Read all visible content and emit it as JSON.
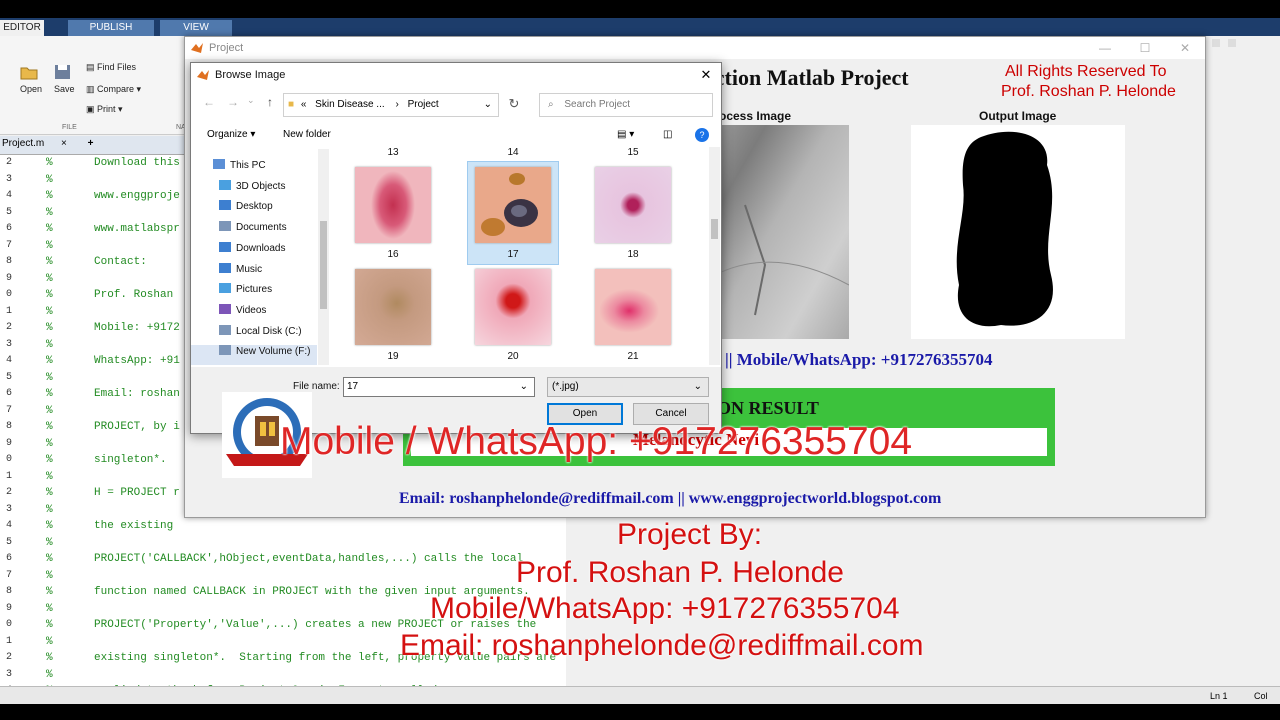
{
  "matlab": {
    "tabs": [
      "EDITOR",
      "PUBLISH",
      "VIEW"
    ],
    "toolstrip": {
      "open": "Open",
      "save": "Save",
      "find_files": "Find Files",
      "compare": "Compare",
      "print": "Print",
      "section_file": "FILE",
      "section_na": "NA"
    },
    "editor_tab": "Project.m",
    "code_lines": [
      {
        "n": "2",
        "text": "Download this"
      },
      {
        "n": "3",
        "text": ""
      },
      {
        "n": "4",
        "text": "www.enggproje"
      },
      {
        "n": "5",
        "text": ""
      },
      {
        "n": "6",
        "text": "www.matlabspr"
      },
      {
        "n": "7",
        "text": ""
      },
      {
        "n": "8",
        "text": "Contact:"
      },
      {
        "n": "9",
        "text": ""
      },
      {
        "n": "0",
        "text": "Prof. Roshan"
      },
      {
        "n": "1",
        "text": ""
      },
      {
        "n": "2",
        "text": "Mobile: +9172"
      },
      {
        "n": "3",
        "text": ""
      },
      {
        "n": "4",
        "text": "WhatsApp: +91"
      },
      {
        "n": "5",
        "text": ""
      },
      {
        "n": "6",
        "text": "Email: roshan"
      },
      {
        "n": "7",
        "text": ""
      },
      {
        "n": "8",
        "text": "PROJECT, by i"
      },
      {
        "n": "9",
        "text": ""
      },
      {
        "n": "0",
        "text": "singleton*."
      },
      {
        "n": "1",
        "text": ""
      },
      {
        "n": "2",
        "text": "H = PROJECT r"
      },
      {
        "n": "3",
        "text": ""
      },
      {
        "n": "4",
        "text": "the existing"
      },
      {
        "n": "5",
        "text": ""
      },
      {
        "n": "6",
        "text": "PROJECT('CALLBACK',hObject,eventData,handles,...) calls the local"
      },
      {
        "n": "7",
        "text": ""
      },
      {
        "n": "8",
        "text": "function named CALLBACK in PROJECT with the given input arguments."
      },
      {
        "n": "9",
        "text": ""
      },
      {
        "n": "0",
        "text": "PROJECT('Property','Value',...) creates a new PROJECT or raises the"
      },
      {
        "n": "1",
        "text": ""
      },
      {
        "n": "2",
        "text": "existing singleton*.  Starting from the left, property value pairs are"
      },
      {
        "n": "3",
        "text": ""
      },
      {
        "n": "4",
        "text": "applied to the before Project_OpeningFcn gets called."
      }
    ],
    "status": {
      "ln": "Ln  1",
      "col": "Col"
    }
  },
  "project_window": {
    "title": "Project",
    "heading": "ection Matlab Project",
    "rights_line1": "All Rights Reserved To",
    "rights_line2": "Prof. Roshan P. Helonde",
    "process_label": "ocess Image",
    "output_label": "Output Image",
    "mobile_line": "||   Mobile/WhatsApp: +917276355704",
    "result_title": "ON RESULT",
    "result_value": "Melanocytic Nevi",
    "email_line": "Email: roshanphelonde@rediffmail.com ||   www.enggprojectworld.blogspot.com"
  },
  "dialog": {
    "title": "Browse Image",
    "breadcrumb_prefix": "«",
    "breadcrumb_folder": "Skin Disease ...",
    "breadcrumb_sep": "›",
    "breadcrumb_current": "Project",
    "search_placeholder": "Search Project",
    "organize": "Organize",
    "new_folder": "New folder",
    "nav": [
      {
        "label": "This PC",
        "icon": "pc-icon"
      },
      {
        "label": "3D Objects",
        "icon": "3d-objects-icon"
      },
      {
        "label": "Desktop",
        "icon": "desktop-icon"
      },
      {
        "label": "Documents",
        "icon": "documents-icon"
      },
      {
        "label": "Downloads",
        "icon": "downloads-icon"
      },
      {
        "label": "Music",
        "icon": "music-icon"
      },
      {
        "label": "Pictures",
        "icon": "pictures-icon"
      },
      {
        "label": "Videos",
        "icon": "videos-icon"
      },
      {
        "label": "Local Disk (C:)",
        "icon": "disk-icon"
      },
      {
        "label": "New Volume (F:)",
        "icon": "drive-icon"
      }
    ],
    "top_numbers": [
      "13",
      "14",
      "15"
    ],
    "files": [
      {
        "name": "16"
      },
      {
        "name": "17"
      },
      {
        "name": "18"
      },
      {
        "name": "19"
      },
      {
        "name": "20"
      },
      {
        "name": "21"
      }
    ],
    "file_name_label": "File name:",
    "file_name_value": "17",
    "file_type_value": "(*.jpg)",
    "open_label": "Open",
    "cancel_label": "Cancel"
  },
  "overlay": {
    "whatsapp": "Mobile / WhatsApp: +917276355704",
    "project_by": "Project By:",
    "name": "Prof. Roshan P. Helonde",
    "mobile": "Mobile/WhatsApp: +917276355704",
    "email": "Email: roshanphelonde@rediffmail.com"
  },
  "colors": {
    "overlay_red": "#d41111",
    "result_green": "#3cc23c",
    "matlab_blue": "#1d3d6b"
  }
}
